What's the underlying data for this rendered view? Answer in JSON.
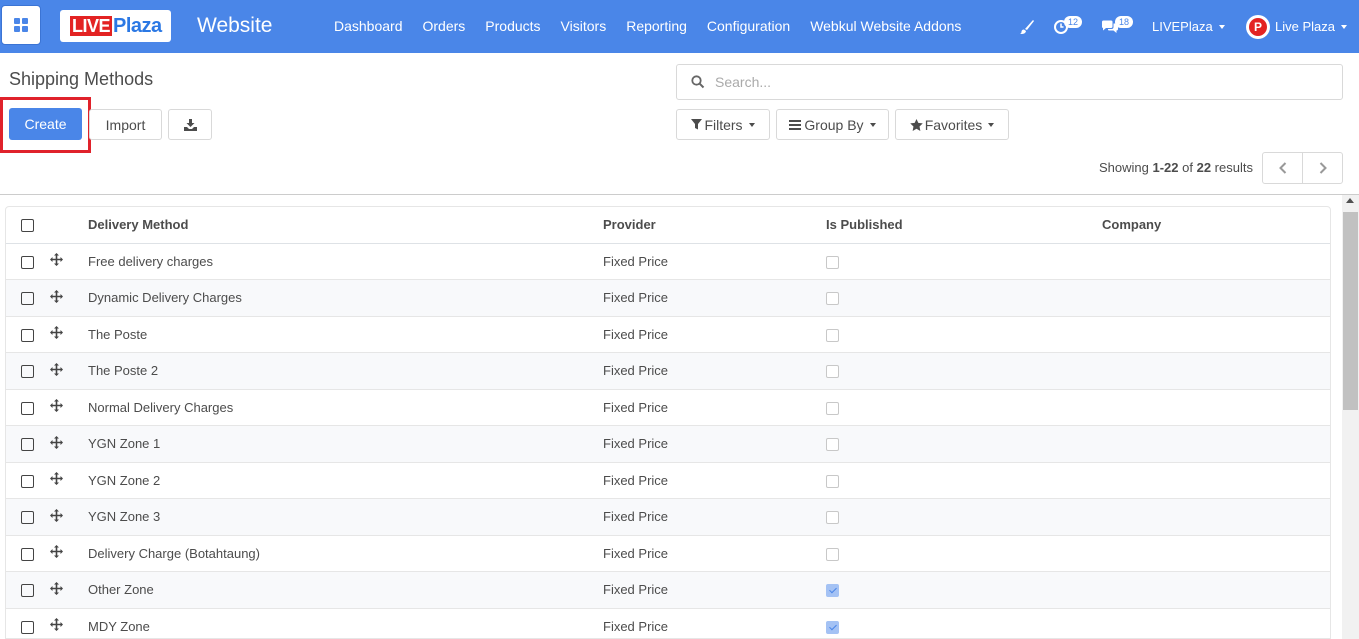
{
  "navbar": {
    "logo_live": "LIVE",
    "logo_plaza": "Plaza",
    "app_title": "Website",
    "menu": [
      "Dashboard",
      "Orders",
      "Products",
      "Visitors",
      "Reporting",
      "Configuration",
      "Webkul Website Addons"
    ],
    "activity_count": "12",
    "messages_count": "18",
    "company": "LIVEPlaza",
    "user": "Live Plaza",
    "avatar_letter": "P"
  },
  "control": {
    "breadcrumb": "Shipping Methods",
    "create_label": "Create",
    "import_label": "Import",
    "search_placeholder": "Search...",
    "filters_label": "Filters",
    "groupby_label": "Group By",
    "favorites_label": "Favorites",
    "pager_prefix": "Showing ",
    "pager_range": "1-22",
    "pager_of": " of ",
    "pager_total": "22",
    "pager_suffix": " results"
  },
  "table": {
    "headers": {
      "delivery_method": "Delivery Method",
      "provider": "Provider",
      "is_published": "Is Published",
      "company": "Company"
    },
    "rows": [
      {
        "name": "Free delivery charges",
        "provider": "Fixed Price",
        "published": false,
        "company": ""
      },
      {
        "name": "Dynamic Delivery Charges",
        "provider": "Fixed Price",
        "published": false,
        "company": ""
      },
      {
        "name": "The Poste",
        "provider": "Fixed Price",
        "published": false,
        "company": ""
      },
      {
        "name": "The Poste 2",
        "provider": "Fixed Price",
        "published": false,
        "company": ""
      },
      {
        "name": "Normal Delivery Charges",
        "provider": "Fixed Price",
        "published": false,
        "company": ""
      },
      {
        "name": "YGN Zone 1",
        "provider": "Fixed Price",
        "published": false,
        "company": ""
      },
      {
        "name": "YGN Zone 2",
        "provider": "Fixed Price",
        "published": false,
        "company": ""
      },
      {
        "name": "YGN Zone 3",
        "provider": "Fixed Price",
        "published": false,
        "company": ""
      },
      {
        "name": "Delivery Charge (Botahtaung)",
        "provider": "Fixed Price",
        "published": false,
        "company": ""
      },
      {
        "name": "Other Zone",
        "provider": "Fixed Price",
        "published": true,
        "company": ""
      },
      {
        "name": "MDY Zone",
        "provider": "Fixed Price",
        "published": true,
        "company": ""
      }
    ]
  },
  "colors": {
    "primary": "#4a86e8",
    "highlight": "#e0222b"
  }
}
